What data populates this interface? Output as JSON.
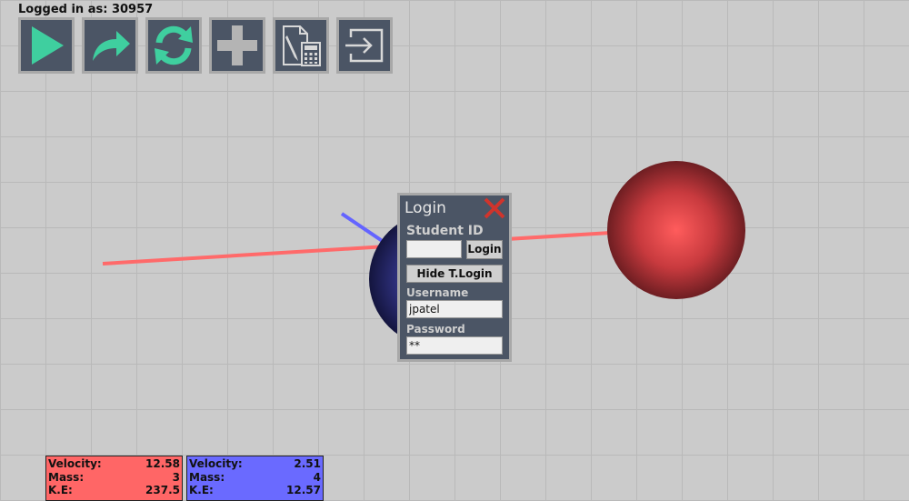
{
  "header": {
    "login_status": "Logged in as: 30957"
  },
  "toolbar": [
    {
      "name": "play-icon",
      "color": "#3fcf9f"
    },
    {
      "name": "redo-arrow-icon",
      "color": "#3fcf9f"
    },
    {
      "name": "refresh-icon",
      "color": "#3fcf9f"
    },
    {
      "name": "plus-icon",
      "color": "#b4b4b4"
    },
    {
      "name": "document-calculator-icon",
      "color": "#d8d8d8"
    },
    {
      "name": "logout-icon",
      "color": "#d8d8d8"
    }
  ],
  "scene": {
    "red_ball_color": "#e04848",
    "blue_ball_color": "#2d2f7a",
    "red_trail_color": "#ff6a6a",
    "blue_trail_color": "#6464ff"
  },
  "login_panel": {
    "title": "Login",
    "student_id_label": "Student ID",
    "student_id_value": "",
    "login_button": "Login",
    "hide_button": "Hide T.Login",
    "username_label": "Username",
    "username_value": "jpatel",
    "password_label": "Password",
    "password_value": "**"
  },
  "stats": [
    {
      "color": "#ff6666",
      "rows": [
        {
          "label": "Velocity:",
          "value": "12.58"
        },
        {
          "label": "Mass:",
          "value": "3"
        },
        {
          "label": "K.E:",
          "value": "237.5"
        }
      ]
    },
    {
      "color": "#6a6aff",
      "rows": [
        {
          "label": "Velocity:",
          "value": "2.51"
        },
        {
          "label": "Mass:",
          "value": "4"
        },
        {
          "label": "K.E:",
          "value": "12.57"
        }
      ]
    }
  ]
}
